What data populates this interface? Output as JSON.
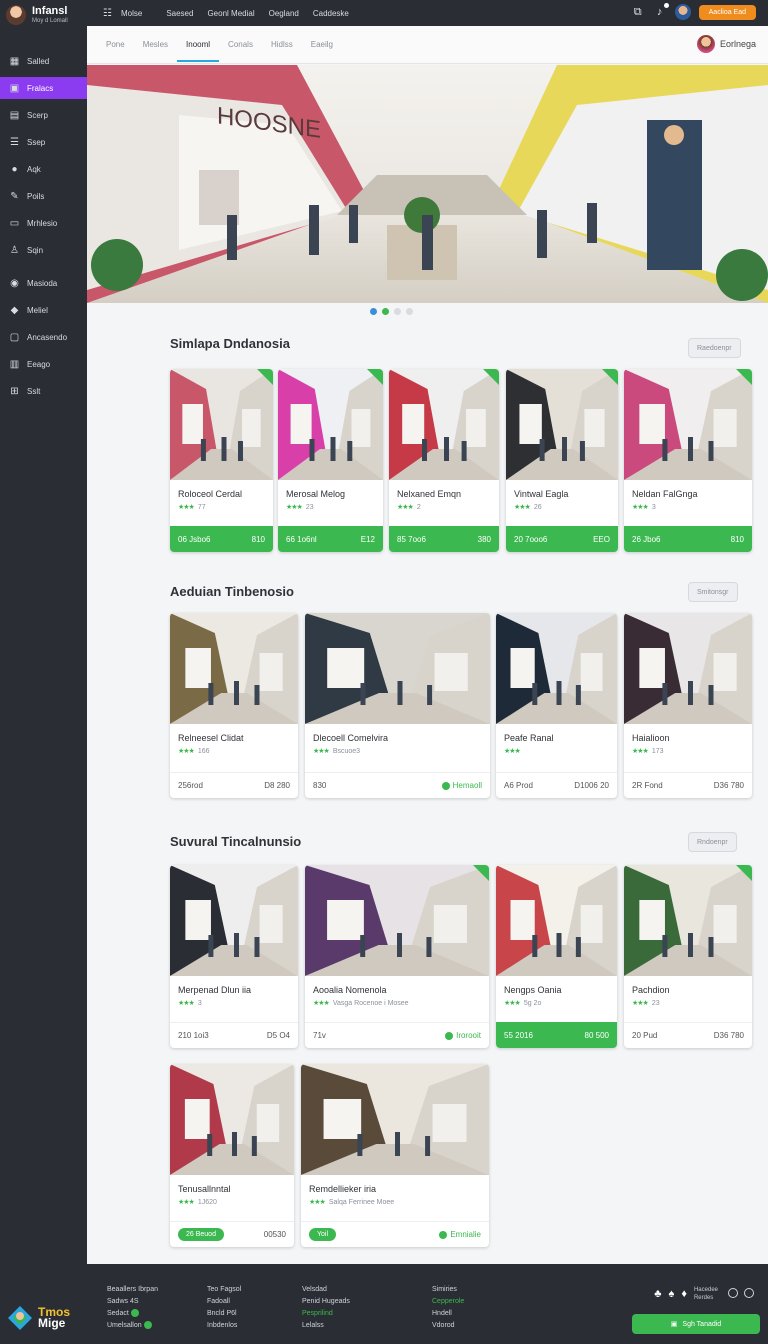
{
  "brand": {
    "title": "Infansl",
    "subtitle": "Moy d Lomall"
  },
  "sidebar": {
    "items": [
      {
        "label": "Salled",
        "icon": "grid-icon"
      },
      {
        "label": "Fralacs",
        "icon": "box-icon",
        "active": true
      },
      {
        "label": "Scerp",
        "icon": "layers-icon"
      },
      {
        "label": "Ssep",
        "icon": "list-icon"
      },
      {
        "label": "Aqk",
        "icon": "user-icon"
      },
      {
        "label": "Poils",
        "icon": "pen-icon"
      },
      {
        "label": "Mrhlesio",
        "icon": "car-icon"
      },
      {
        "label": "Sqin",
        "icon": "person-icon"
      },
      {
        "label": "Masioda",
        "icon": "pin-icon"
      },
      {
        "label": "Meliel",
        "icon": "tag-icon"
      },
      {
        "label": "Ancasendo",
        "icon": "window-icon"
      },
      {
        "label": "Eeago",
        "icon": "chart-icon"
      },
      {
        "label": "Sslt",
        "icon": "table-icon"
      }
    ],
    "logo": {
      "line1": "Tmos",
      "line2": "Mige"
    }
  },
  "topbar": {
    "menu_icon": "menu-icon",
    "home_label": "Molse",
    "links": [
      "Saesed",
      "Geonl Medial",
      "Oegland",
      "Caddeske"
    ],
    "cta_label": "Aaclioa Ead"
  },
  "tabs": {
    "items": [
      "Pone",
      "Mesles",
      "Inooml",
      "Conals",
      "Hidlss",
      "Eaeilg"
    ],
    "active_index": 2,
    "user_name": "Eorlnega"
  },
  "sections": [
    {
      "title": "Simlapa Dndanosia",
      "button": "Raedoenpr",
      "cards": [
        {
          "name": "Roloceol Cerdal",
          "rating": "77",
          "price": "06 Jsbo6",
          "extra": "810",
          "green": true,
          "corner": true
        },
        {
          "name": "Merosal Melog",
          "rating": "23",
          "price": "66 1o6nl",
          "extra": "E12",
          "green": true,
          "corner": true
        },
        {
          "name": "Nelxaned Emqn",
          "rating": "2",
          "price": "85 7oo6",
          "extra": "380",
          "green": true,
          "corner": true
        },
        {
          "name": "Vintwal Eagla",
          "rating": "26",
          "price": "20 7ooo6",
          "extra": "EEO",
          "green": true,
          "corner": true
        },
        {
          "name": "Neldan FalGnga",
          "rating": "3",
          "price": "26 Jbo6",
          "extra": "810",
          "green": true,
          "corner": true
        }
      ]
    },
    {
      "title": "Aeduian Tinbenosio",
      "button": "Smitonsgr",
      "cards": [
        {
          "name": "Relneesel Clidat",
          "rating": "166",
          "price": "256rod",
          "extra": "D8 280"
        },
        {
          "name": "Dlecoell Comelvira",
          "rating": "Bscuoe3",
          "price": "830",
          "pill": "Hemaoll"
        },
        {
          "name": "Peafe Ranal",
          "rating": "",
          "price": "A6 Prod",
          "extra": "D1006 20"
        },
        {
          "name": "Haialioon",
          "rating": "173",
          "price": "2R Fond",
          "extra": "D36 780"
        }
      ]
    },
    {
      "title": "Suvural Tincalnunsio",
      "button": "Rndoenpr",
      "cards": [
        {
          "name": "Merpenad Dlun iia",
          "rating": "3",
          "price": "210 1oi3",
          "extra": "D5 O4"
        },
        {
          "name": "Aooalia Nomenola",
          "rating": "Vasga Rocenoe i Mosee",
          "price": "71v",
          "pill": "Irorooit",
          "corner": true
        },
        {
          "name": "Nengps Oania",
          "rating": "5g 2o",
          "price": "55 2016",
          "extra": "80 500",
          "green": true
        },
        {
          "name": "Pachdion",
          "rating": "23",
          "price": "20 Pud",
          "extra": "D36 780",
          "corner": true
        },
        {
          "name": "Tenusallnntal",
          "rating": "1J620",
          "price": "26 Beuod",
          "extra": "00530",
          "btn": true
        },
        {
          "name": "Remdellieker iria",
          "rating": "Salqa Ferrinee Moee",
          "price": "Yoil",
          "pill": "Emnialie",
          "btn": true
        }
      ]
    }
  ],
  "footer": {
    "col1": [
      "Beaallers Ibrpan",
      "Sadws 4S",
      "Sedact",
      "Umelsallon"
    ],
    "col2": [
      "Teo Fagsol",
      "Fadoall",
      "Bncld P6l",
      "Inbdenlos"
    ],
    "col3": [
      "Velsdad",
      "Penid Hugeads",
      "Pesprilind",
      "Lelalss"
    ],
    "col4": [
      "Simiries",
      "Cepperole",
      "Hndell",
      "Vdorod"
    ],
    "social_text": [
      "Hacedee",
      "Rerdes"
    ],
    "button_label": "Sgh Tanadid"
  },
  "colors": {
    "accent": "#8b3cf0",
    "green": "#3cb850",
    "orange": "#f08c1e",
    "dark": "#2a2d33"
  }
}
